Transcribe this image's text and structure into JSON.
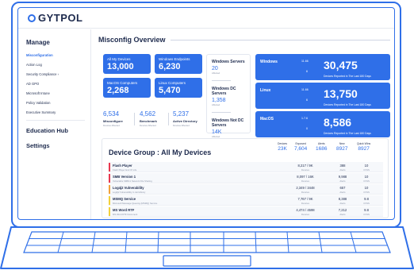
{
  "brand": {
    "logo_text": "GYTPOL"
  },
  "sidebar": {
    "manage_label": "Manage",
    "items": [
      {
        "label": "Misconfiguration",
        "active": true
      },
      {
        "label": "Action Log"
      },
      {
        "label": "Security Compliance  ›"
      },
      {
        "label": "AD GPO"
      },
      {
        "label": "Microsoft Intune"
      },
      {
        "label": "Policy Validation"
      },
      {
        "label": "Executive Summary"
      }
    ],
    "education_label": "Education Hub",
    "settings_label": "Settings"
  },
  "main": {
    "title": "Misconfig Overview",
    "tiles": [
      {
        "label": "All My Devices",
        "value": "13,000"
      },
      {
        "label": "Windows Endpoints",
        "value": "6,230"
      },
      {
        "label": "MacOS Computers",
        "value": "2,268"
      },
      {
        "label": "Linux Computers",
        "value": "5,470"
      }
    ],
    "metrics": [
      {
        "value": "6,534",
        "label": "Misconfigure",
        "sub": "Devices Affected"
      },
      {
        "value": "4,562",
        "label": "Benchmark",
        "sub": "Devices Affected"
      },
      {
        "value": "5,237",
        "label": "Active Directory",
        "sub": "Devices Affected"
      }
    ],
    "servers": [
      {
        "title": "Windows Servers",
        "value": "20",
        "sub": "Affected"
      },
      {
        "title": "Windows DC Servers",
        "value": "1,358",
        "sub": "Affected"
      },
      {
        "title": "Windows Not DC Servers",
        "value": "14K",
        "sub": "Affected"
      }
    ],
    "os_cards": [
      {
        "name": "Windows",
        "version": "11.66",
        "mid": "6",
        "date": "1/2/2023",
        "when": "Today",
        "big": "30,475",
        "note": "Devices Reported in The Last 180 Days"
      },
      {
        "name": "Linux",
        "version": "11.66",
        "mid": "6",
        "date": "1/2/2023",
        "when": "Today",
        "big": "13,750",
        "note": "Devices Reported in The Last 180 Days"
      },
      {
        "name": "MacOS",
        "version": "1.7.6",
        "mid": "0",
        "date": "1/2/2023",
        "when": "Today",
        "big": "8,586",
        "note": "Devices Reported in The Last 180 Days"
      }
    ]
  },
  "device_group": {
    "title": "Device Group : All My Devices",
    "stats": [
      {
        "label": "Devices",
        "value": "23K"
      },
      {
        "label": "Exposed",
        "value": "7,604"
      },
      {
        "label": "Alerts",
        "value": "1686"
      },
      {
        "label": "New",
        "value": "8927"
      },
      {
        "label": "Quick Wins",
        "value": "8927"
      }
    ],
    "rows": [
      {
        "name": "Flash Player",
        "desc": "Flash Player End Of Life",
        "devices": "8,217 / 9K",
        "devices_label": "Devices",
        "alerts": "388",
        "alerts_label": "Alerts",
        "cvss": "10",
        "cvss_label": "CVSS",
        "color": "#e8384f"
      },
      {
        "name": "SMB Version 1",
        "desc": "Vulnerable SMBv1 Network File Sharing",
        "devices": "8,097 / 16K",
        "devices_label": "Devices",
        "alerts": "9,988",
        "alerts_label": "Alerts",
        "cvss": "10",
        "cvss_label": "CVSS",
        "color": "#e8384f"
      },
      {
        "name": "Log4j2 Vulnerability",
        "desc": "Log4j2 Vulnerability in Jar/Library",
        "devices": "2,349 / 3448",
        "devices_label": "Devices",
        "alerts": "657",
        "alerts_label": "Alerts",
        "cvss": "10",
        "cvss_label": "CVSS",
        "color": "#f2a23a"
      },
      {
        "name": "MSMQ Service",
        "desc": "Microsoft Message Queuing (MSMQ) Service",
        "devices": "7,767 / 9K",
        "devices_label": "Devices",
        "alerts": "8,388",
        "alerts_label": "Alerts",
        "cvss": "9.8",
        "cvss_label": "CVSS",
        "color": "#f2d03a"
      },
      {
        "name": "MS Word RTF",
        "desc": "MS Word RTF Document",
        "devices": "4,474 / 4598",
        "devices_label": "Devices",
        "alerts": "7,212",
        "alerts_label": "Alerts",
        "cvss": "9.8",
        "cvss_label": "CVSS",
        "color": "#f2d03a"
      }
    ]
  },
  "colors": {
    "accent": "#2f6fe8",
    "text": "#1d2a4d",
    "critical": "#e8384f",
    "high": "#f2a23a",
    "medium": "#f2d03a"
  }
}
